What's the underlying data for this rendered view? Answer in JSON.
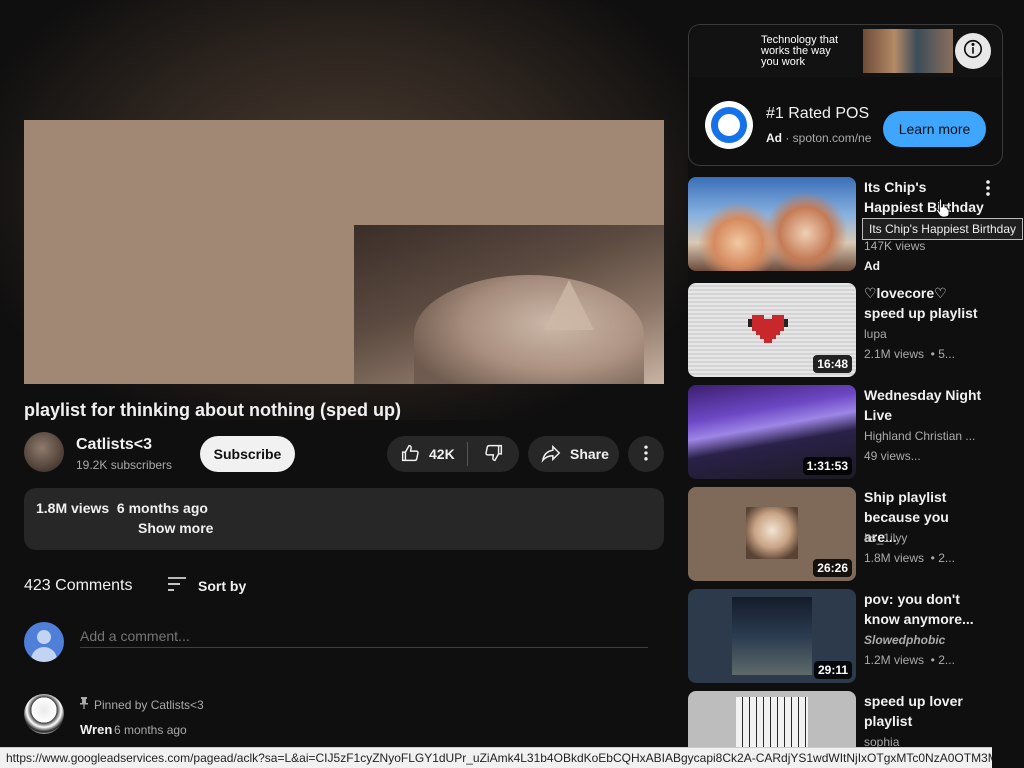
{
  "video": {
    "title": "playlist for thinking about nothing (sped up)",
    "channel_name": "Catlists<3",
    "subscribers": "19.2K subscribers",
    "subscribe_label": "Subscribe",
    "likes": "42K",
    "share_label": "Share"
  },
  "description": {
    "views_date": "1.8M views  6 months ago",
    "show_more": "Show more"
  },
  "comments": {
    "count": "423 Comments",
    "sort_label": "Sort by",
    "add_placeholder": "Add a comment...",
    "pinned_by": "Pinned by Catlists<3",
    "first_author": "Wren",
    "first_time": "6 months ago"
  },
  "ad": {
    "banner_text": "Technology that works the way you work",
    "title": "#1 Rated POS",
    "ad_label": "Ad",
    "domain": "spoton.com/ne",
    "cta": "Learn more"
  },
  "recommendations": [
    {
      "title": "Its Chip's Happiest Birthday",
      "stats": "147K views",
      "badge": "Ad"
    },
    {
      "title": "♡lovecore♡ speed up playlist",
      "channel": "lupa",
      "stats": "2.1M views  • 5...",
      "duration": "16:48"
    },
    {
      "title": "Wednesday Night Live",
      "channel": "Highland Christian ...",
      "stats": "49 views...",
      "duration": "1:31:53"
    },
    {
      "title": "Ship playlist because you are...",
      "channel": "Its_1ilyy",
      "stats": "1.8M views  • 2...",
      "duration": "26:26"
    },
    {
      "title": "pov: you don't know anymore...",
      "channel": "Slowedphobic",
      "stats": "1.2M views  • 2...",
      "duration": "29:11"
    },
    {
      "title": "speed up lover playlist",
      "channel": "sophia"
    }
  ],
  "tooltip": "Its Chip's Happiest Birthday",
  "status_url": "https://www.googleadservices.com/pagead/aclk?sa=L&ai=CIJ5zF1cyZNyoFLGY1dUPr_uZiAmk4L31b4OBkdKoEbCQHxABIABgycapi8Ck2A-CARdjYS1wdWItNjIxOTgxMTc0NzA0OTM3MaA..."
}
